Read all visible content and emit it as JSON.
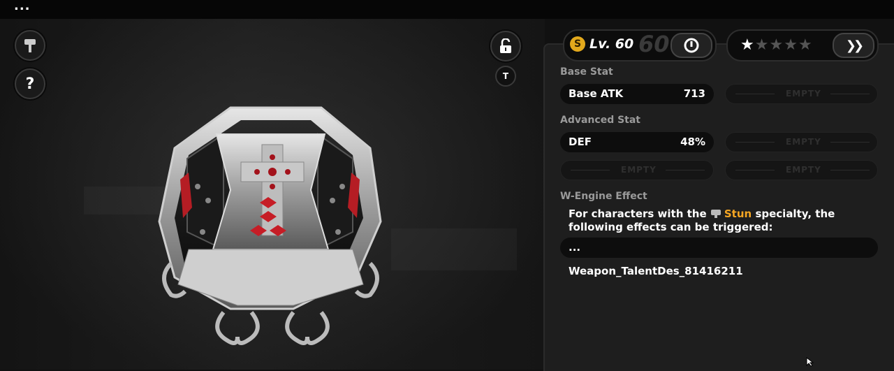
{
  "top_bar": {
    "menu_glyph": "..."
  },
  "left_controls": {
    "weapon_icon": "hammer-icon",
    "help_label": "?",
    "lock_icon": "unlock-icon",
    "tag_label": "T"
  },
  "level": {
    "coin_symbol": "S",
    "label": "Lv. 60",
    "max": "60"
  },
  "rarity": {
    "stars_filled": 1,
    "stars_total": 5,
    "next_label": "❯❯"
  },
  "base_stat": {
    "title": "Base Stat",
    "name": "Base ATK",
    "value": "713",
    "empty_label": "EMPTY"
  },
  "advanced_stat": {
    "title": "Advanced Stat",
    "name": "DEF",
    "value": "48%",
    "empty_label": "EMPTY"
  },
  "engine_effect": {
    "title": "W-Engine Effect",
    "text_before": "For characters with the ",
    "highlight": "Stun",
    "text_after": " specialty, the following effects can be triggered:",
    "collapsed_label": "...",
    "talent_text": "Weapon_TalentDes_81416211"
  },
  "colors": {
    "accent": "#f5a623",
    "panel": "#1e1e1e",
    "coin": "#e3a91c"
  }
}
